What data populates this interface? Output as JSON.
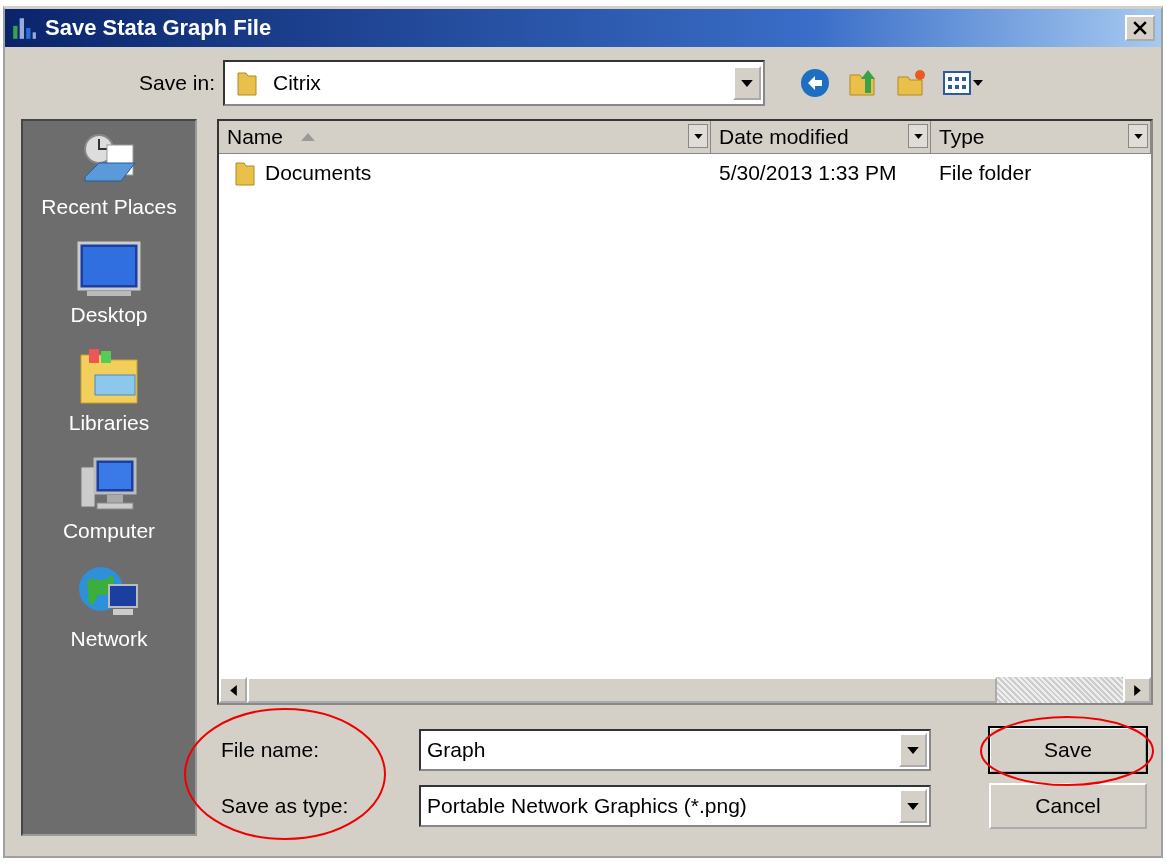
{
  "window": {
    "title": "Save Stata Graph File"
  },
  "save_in": {
    "label": "Save in:",
    "value": "Citrix"
  },
  "sidebar": {
    "items": [
      {
        "label": "Recent Places",
        "kind": "recent"
      },
      {
        "label": "Desktop",
        "kind": "desktop"
      },
      {
        "label": "Libraries",
        "kind": "libraries"
      },
      {
        "label": "Computer",
        "kind": "computer"
      },
      {
        "label": "Network",
        "kind": "network"
      }
    ]
  },
  "table": {
    "columns": [
      {
        "label": "Name",
        "sorted": true
      },
      {
        "label": "Date modified",
        "sorted": false
      },
      {
        "label": "Type",
        "sorted": false
      }
    ],
    "rows": [
      {
        "name": "Documents",
        "date": "5/30/2013 1:33 PM",
        "type": "File folder"
      }
    ]
  },
  "file_name": {
    "label": "File name:",
    "value": "Graph"
  },
  "save_as_type": {
    "label": "Save as type:",
    "value": "Portable Network Graphics (*.png)"
  },
  "buttons": [
    {
      "label": "Save",
      "default": true
    },
    {
      "label": "Cancel",
      "default": false
    }
  ]
}
